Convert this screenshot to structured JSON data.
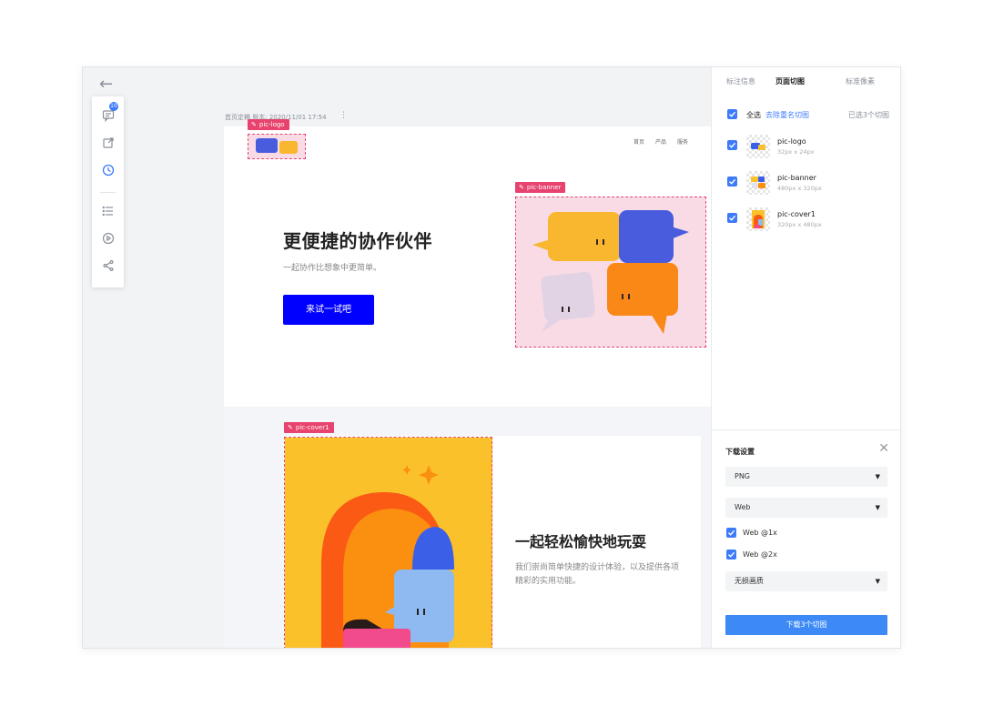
{
  "toolbar": {
    "comments_badge": "10",
    "tools": [
      "comments-icon",
      "export-icon",
      "history-icon",
      "list-icon",
      "play-icon",
      "share-icon"
    ]
  },
  "meta": {
    "prefix": "首页定稿",
    "version": "版本: 2020/11/01 17:54",
    "more": "⋮"
  },
  "page": {
    "nav": [
      "首页",
      "产品",
      "服务"
    ],
    "hero_title": "更便捷的协作伙伴",
    "hero_subtitle": "一起协作比想象中更简单。",
    "hero_button": "来试一试吧",
    "section2_title": "一起轻松愉快地玩耍",
    "section2_desc": "我们崇尚简单快捷的设计体验，以及提供各项精彩的实用功能。"
  },
  "slice_tags": {
    "logo": "pic-logo",
    "banner": "pic-banner",
    "cover": "pic-cover1"
  },
  "panel": {
    "tabs": [
      "标注信息",
      "页面切图",
      "标准像素"
    ],
    "active_tab": "页面切图",
    "select_all": "全选",
    "dedupe": "去除重名切图",
    "selected_count": "已选3个切图",
    "slices": [
      {
        "name": "pic-logo",
        "size": "32px x 24px"
      },
      {
        "name": "pic-banner",
        "size": "480px x 320px"
      },
      {
        "name": "pic-cover1",
        "size": "320px x 480px"
      }
    ],
    "download": {
      "title": "下载设置",
      "format": "PNG",
      "platform": "Web",
      "options": [
        "Web @1x",
        "Web @2x"
      ],
      "quality": "无损画质",
      "button": "下载3个切图"
    }
  },
  "colors": {
    "accent": "#3d7bfa",
    "slice_highlight": "#e8426e",
    "hero_button": "#0000ff"
  }
}
